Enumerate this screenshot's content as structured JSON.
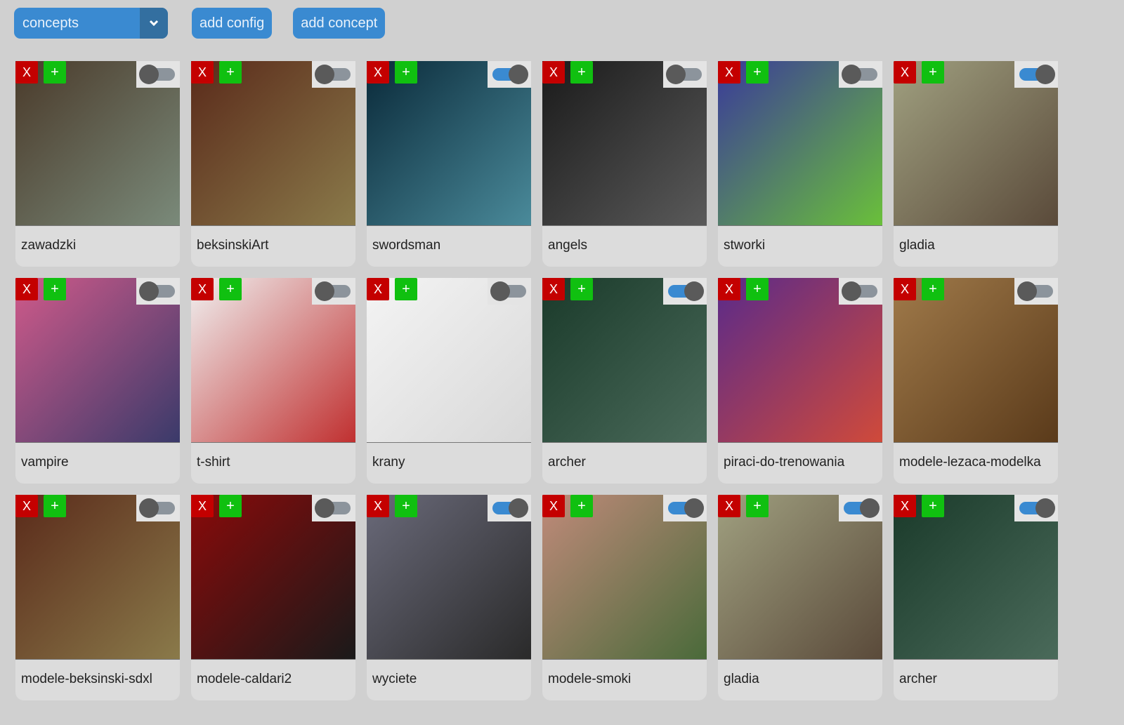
{
  "toolbar": {
    "select_value": "concepts",
    "add_config_label": "add config",
    "add_concept_label": "add concept",
    "accent": "#3a8ad1"
  },
  "card_buttons": {
    "delete": "X",
    "add": "+"
  },
  "cards": [
    {
      "name": "zawadzki",
      "enabled": false,
      "thumb": [
        "#4a3a2a",
        "#7a8a7a"
      ]
    },
    {
      "name": "beksinskiArt",
      "enabled": false,
      "thumb": [
        "#5a2a1a",
        "#8a7a4a"
      ]
    },
    {
      "name": "swordsman",
      "enabled": true,
      "thumb": [
        "#0a2a3a",
        "#4a8a9a"
      ]
    },
    {
      "name": "angels",
      "enabled": false,
      "thumb": [
        "#1a1a1a",
        "#5a5a5a"
      ]
    },
    {
      "name": "stworki",
      "enabled": false,
      "thumb": [
        "#3a3a9a",
        "#6ac03a"
      ]
    },
    {
      "name": "gladia",
      "enabled": true,
      "thumb": [
        "#a0a080",
        "#5a4a3a"
      ]
    },
    {
      "name": "vampire",
      "enabled": false,
      "thumb": [
        "#d05a8a",
        "#3a3a6a"
      ]
    },
    {
      "name": "t-shirt",
      "enabled": false,
      "thumb": [
        "#f0f0f0",
        "#c03030"
      ]
    },
    {
      "name": "krany",
      "enabled": false,
      "thumb": [
        "#f4f4f4",
        "#d8d8d8"
      ]
    },
    {
      "name": "archer",
      "enabled": true,
      "thumb": [
        "#1a3a2a",
        "#4a6a5a"
      ]
    },
    {
      "name": "piraci-do-trenowania",
      "enabled": false,
      "thumb": [
        "#5a2a8a",
        "#d04a3a"
      ]
    },
    {
      "name": "modele-lezaca-modelka",
      "enabled": false,
      "thumb": [
        "#a07a4a",
        "#5a3a1a"
      ]
    },
    {
      "name": "modele-beksinski-sdxl",
      "enabled": false,
      "thumb": [
        "#5a2a1a",
        "#8a7a4a"
      ]
    },
    {
      "name": "modele-caldari2",
      "enabled": false,
      "thumb": [
        "#8a0a0a",
        "#1a1a1a"
      ]
    },
    {
      "name": "wyciete",
      "enabled": true,
      "thumb": [
        "#6a6a7a",
        "#2a2a2a"
      ]
    },
    {
      "name": "modele-smoki",
      "enabled": true,
      "thumb": [
        "#c08a7a",
        "#4a6a3a"
      ]
    },
    {
      "name": "gladia",
      "enabled": true,
      "thumb": [
        "#a0a080",
        "#5a4a3a"
      ]
    },
    {
      "name": "archer",
      "enabled": true,
      "thumb": [
        "#1a3a2a",
        "#4a6a5a"
      ]
    }
  ]
}
